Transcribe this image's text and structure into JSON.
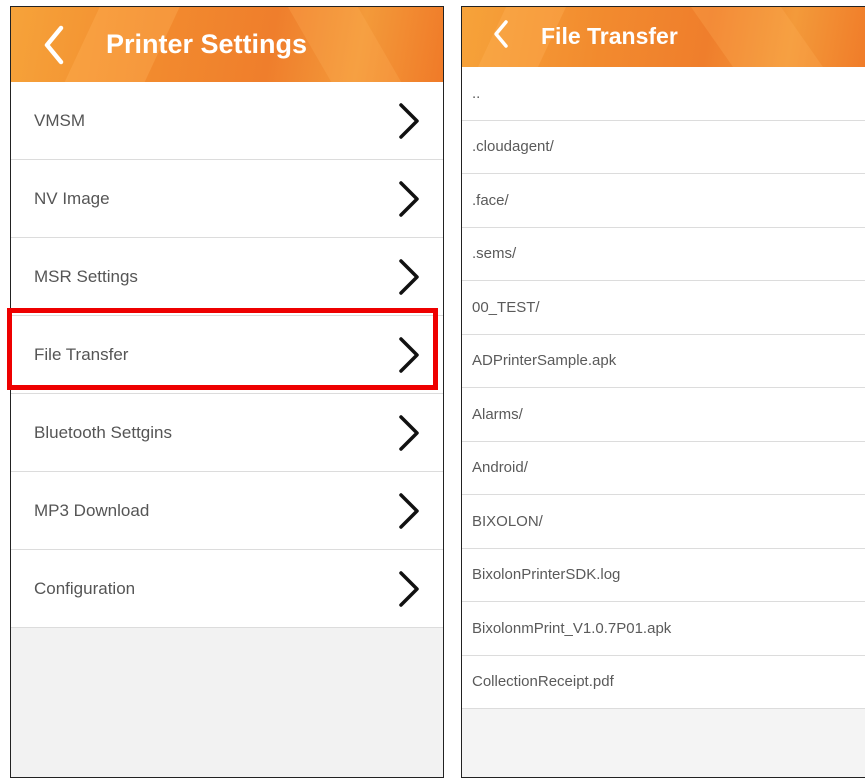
{
  "left": {
    "title": "Printer Settings",
    "back_glyph": "‹",
    "items": [
      {
        "label": "VMSM"
      },
      {
        "label": "NV Image"
      },
      {
        "label": "MSR Settings"
      },
      {
        "label": "File Transfer"
      },
      {
        "label": "Bluetooth Settgins"
      },
      {
        "label": "MP3 Download"
      },
      {
        "label": "Configuration"
      }
    ],
    "highlighted_item": "File Transfer",
    "highlight_color": "#ee0000"
  },
  "right": {
    "title": "File Transfer",
    "back_glyph": "‹",
    "files": [
      {
        "label": ".."
      },
      {
        "label": ".cloudagent/"
      },
      {
        "label": ".face/"
      },
      {
        "label": ".sems/"
      },
      {
        "label": "00_TEST/"
      },
      {
        "label": "ADPrinterSample.apk"
      },
      {
        "label": "Alarms/"
      },
      {
        "label": "Android/"
      },
      {
        "label": "BIXOLON/"
      },
      {
        "label": "BixolonPrinterSDK.log"
      },
      {
        "label": "BixolonmPrint_V1.0.7P01.apk"
      },
      {
        "label": "CollectionReceipt.pdf"
      }
    ]
  },
  "colors": {
    "header_orange": "#f28a2e",
    "row_bg": "#ffffff",
    "panel_bg": "#f2f2f2"
  },
  "icons": {
    "back": "chevron-left-icon",
    "item": "chevron-right-icon"
  }
}
